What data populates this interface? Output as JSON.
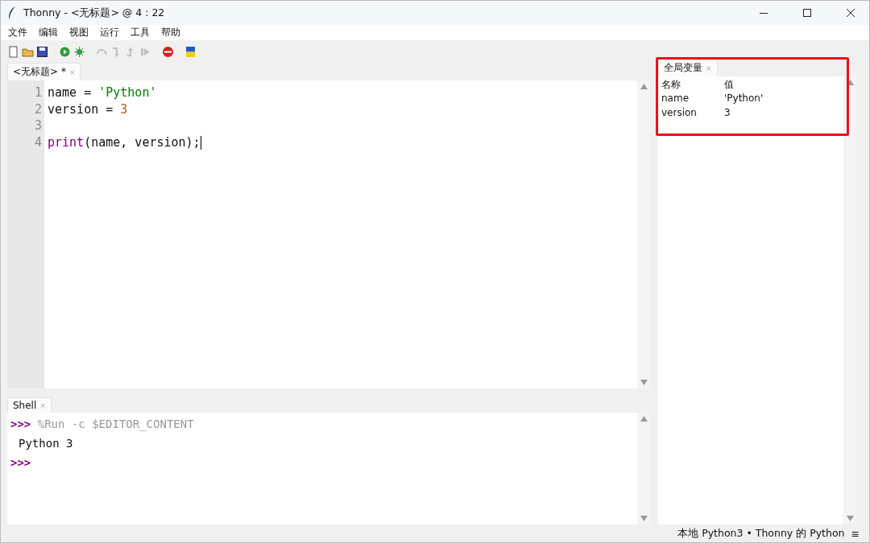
{
  "window": {
    "title": "Thonny  -  <无标题>  @  4 : 22"
  },
  "menu": [
    "文件",
    "编辑",
    "视图",
    "运行",
    "工具",
    "帮助"
  ],
  "toolbar": [
    {
      "kind": "new",
      "disabled": false
    },
    {
      "kind": "open",
      "disabled": false
    },
    {
      "kind": "save",
      "disabled": false
    },
    {
      "kind": "run",
      "disabled": false
    },
    {
      "kind": "debug",
      "disabled": false
    },
    {
      "kind": "step-over",
      "disabled": true
    },
    {
      "kind": "step-into",
      "disabled": true
    },
    {
      "kind": "step-out",
      "disabled": true
    },
    {
      "kind": "resume",
      "disabled": true
    },
    {
      "kind": "stop",
      "disabled": false
    },
    {
      "kind": "flag",
      "disabled": false
    }
  ],
  "editor": {
    "tab": {
      "label": "<无标题> *",
      "close": "×"
    },
    "lines": [
      {
        "number": "1",
        "tokens": [
          {
            "kind": "plain",
            "text": "name = "
          },
          {
            "kind": "string",
            "text": "'Python'"
          }
        ]
      },
      {
        "number": "2",
        "tokens": [
          {
            "kind": "plain",
            "text": "version = "
          },
          {
            "kind": "number",
            "text": "3"
          }
        ]
      },
      {
        "number": "3"
      },
      {
        "number": "4",
        "tokens": [
          {
            "kind": "builtin",
            "text": "print"
          },
          {
            "kind": "plain",
            "text": "(name, version);"
          }
        ]
      }
    ]
  },
  "shell": {
    "tab": {
      "label": "Shell",
      "close": "×"
    },
    "lines": [
      {
        "kind": "command",
        "prompt": ">>>",
        "text": "%Run -c $EDITOR_CONTENT"
      },
      {
        "kind": "output",
        "text": "Python 3"
      },
      {
        "kind": "prompt",
        "prompt": ">>>"
      }
    ]
  },
  "variables": {
    "tab": {
      "label": "全局变量",
      "close": "×"
    },
    "columns": [
      "名称",
      "值"
    ],
    "rows": [
      [
        "name",
        "'Python'"
      ],
      [
        "version",
        "3"
      ]
    ]
  },
  "status_bar": {
    "interpreter": "本地 Python3  •  Thonny 的 Python",
    "menu": "≡"
  }
}
